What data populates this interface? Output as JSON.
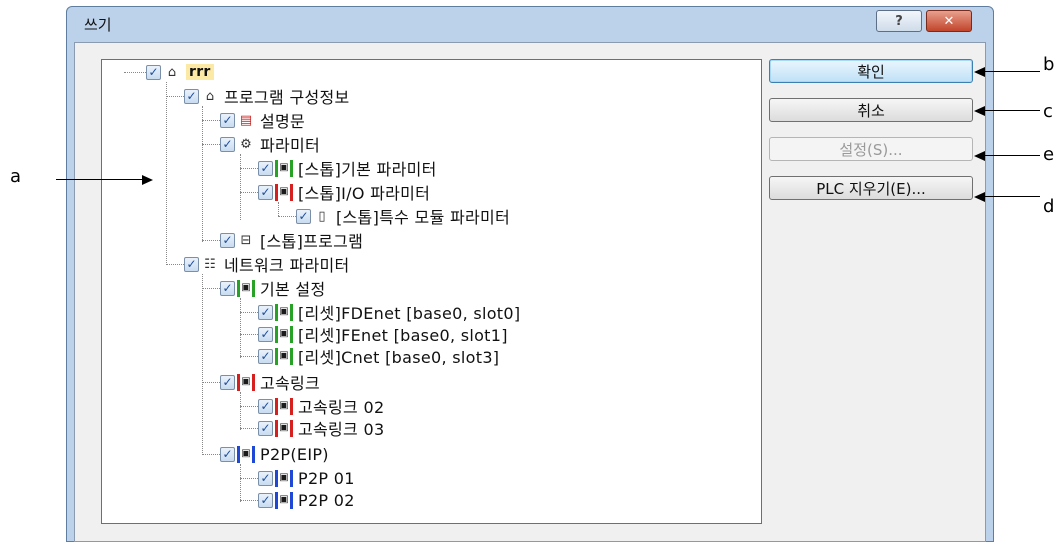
{
  "window": {
    "title": "쓰기",
    "help_glyph": "?",
    "close_glyph": "✕"
  },
  "tree": {
    "check_glyph": "✓",
    "nodes": [
      {
        "label": "rrr",
        "icon": "project-icon"
      },
      {
        "label": "프로그램 구성정보",
        "icon": "project-icon"
      },
      {
        "label": "설명문",
        "icon": "document-icon"
      },
      {
        "label": "파라미터",
        "icon": "parameter-icon"
      },
      {
        "label": "[스톱]기본 파라미터",
        "icon": "basic-parameter-icon"
      },
      {
        "label": "[스톱]I/O 파라미터",
        "icon": "io-parameter-icon"
      },
      {
        "label": "[스톱]특수 모듈 파라미터",
        "icon": "special-module-icon"
      },
      {
        "label": "[스톱]프로그램",
        "icon": "program-icon"
      },
      {
        "label": "네트워크 파라미터",
        "icon": "network-icon"
      },
      {
        "label": "기본 설정",
        "icon": "green-module-icon"
      },
      {
        "label": "[리셋]FDEnet [base0, slot0]",
        "icon": "green-module-icon"
      },
      {
        "label": "[리셋]FEnet [base0, slot1]",
        "icon": "green-module-icon"
      },
      {
        "label": "[리셋]Cnet [base0, slot3]",
        "icon": "green-module-icon"
      },
      {
        "label": "고속링크",
        "icon": "red-module-icon"
      },
      {
        "label": "고속링크 02",
        "icon": "red-module-icon"
      },
      {
        "label": "고속링크 03",
        "icon": "red-module-icon"
      },
      {
        "label": "P2P(EIP)",
        "icon": "blue-module-icon"
      },
      {
        "label": "P2P 01",
        "icon": "blue-module-icon"
      },
      {
        "label": "P2P 02",
        "icon": "blue-module-icon"
      }
    ]
  },
  "buttons": {
    "ok": "확인",
    "cancel": "취소",
    "settings": "설정(S)...",
    "plc_clear": "PLC 지우기(E)..."
  },
  "callouts": {
    "a": "a",
    "b": "b",
    "c": "c",
    "d": "d",
    "e": "e"
  }
}
